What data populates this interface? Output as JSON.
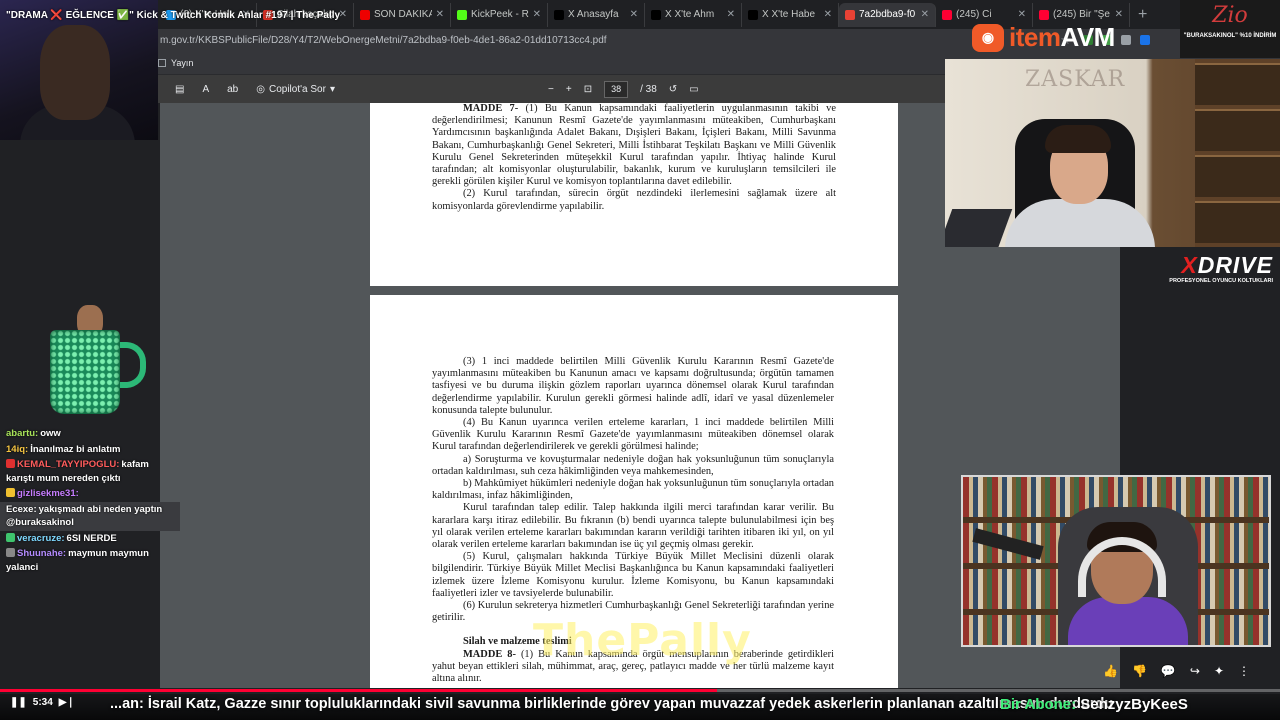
{
  "browser": {
    "tabs": [
      {
        "title": "(6) X'te Hal",
        "color": "#1d9bf0"
      },
      {
        "title": "Silah kaçakç",
        "color": "#d93025"
      },
      {
        "title": "SON DAKİKA",
        "color": "#e00"
      },
      {
        "title": "KickPeek - R",
        "color": "#53fc18"
      },
      {
        "title": "X Anasayfa",
        "color": "#000000"
      },
      {
        "title": "X X'te Ahm",
        "color": "#000000"
      },
      {
        "title": "X X'te Habe",
        "color": "#000000"
      },
      {
        "title": "7a2bdba9-f0",
        "color": "#e94235",
        "active": true
      },
      {
        "title": "(245) Ci",
        "color": "#ff0033"
      },
      {
        "title": "(245) Bir \"Şe",
        "color": "#ff0033"
      }
    ],
    "url": "m.gov.tr/KKBSPublicFile/D28/Y4/T2/WebOnergeMetni/7a2bdba9-f0eb-4de1-86a2-01dd10713cc4.pdf",
    "bookmark": "Yayın"
  },
  "pdf_toolbar": {
    "copilot": "Copilot'a Sor",
    "current_page": "38",
    "total_pages": "/ 38",
    "zoom_out": "−",
    "zoom_in": "+"
  },
  "document": {
    "page1": {
      "article_title": "MADDE 7-",
      "para1": "(1) Bu Kanun kapsamındaki faaliyetlerin uygulanmasının takibi ve değerlendirilmesi; Kanunun Resmî Gazete'de yayımlanmasını müteakiben, Cumhurbaşkanı Yardımcısının başkanlığında Adalet Bakanı, Dışişleri Bakanı, İçişleri Bakanı, Milli Savunma Bakanı, Cumhurbaşkanlığı Genel Sekreteri, Milli İstihbarat Teşkilatı Başkanı ve Milli Güvenlik Kurulu Genel Sekreterinden müteşekkil Kurul tarafından yapılır. İhtiyaç halinde Kurul tarafından; alt komisyonlar oluşturulabilir, bakanlık, kurum ve kuruluşların temsilcileri ile gerekli görülen kişiler Kurul ve komisyon toplantılarına davet edilebilir.",
      "para2": "(2) Kurul tarafından, sürecin örgüt nezdindeki ilerlemesini sağlamak üzere alt komisyonlarda görevlendirme yapılabilir."
    },
    "page2": {
      "p3": "(3) 1 inci maddede belirtilen Milli Güvenlik Kurulu Kararının Resmî Gazete'de yayımlanmasını müteakiben bu Kanunun amacı ve kapsamı doğrultusunda; örgütün tamamen tasfiyesi ve bu duruma ilişkin gözlem raporları uyarınca dönemsel olarak Kurul tarafından değerlendirme yapılabilir. Kurulun gerekli görmesi halinde adlî, idarî ve yasal düzenlemeler konusunda talepte bulunulur.",
      "p4": "(4) Bu Kanun uyarınca verilen erteleme kararları, 1 inci maddede belirtilen Milli Güvenlik Kurulu Kararının Resmî Gazete'de yayımlanmasını müteakiben dönemsel olarak Kurul tarafından değerlendirilerek ve gerekli görülmesi halinde;",
      "pa": "a) Soruşturma ve kovuşturmalar nedeniyle doğan hak yoksunluğunun tüm sonuçlarıyla ortadan kaldırılması, suh ceza hâkimliğinden veya mahkemesinden,",
      "pb": "b) Mahkûmiyet hükümleri nedeniyle doğan hak yoksunluğunun tüm sonuçlarıyla ortadan kaldırılması, infaz hâkimliğinden,",
      "pc": "Kurul tarafından talep edilir. Talep hakkında ilgili merci tarafından karar verilir. Bu kararlara karşı itiraz edilebilir. Bu fıkranın (b) bendi uyarınca talepte bulunulabilmesi için beş yıl olarak verilen erteleme kararları bakımından kararın verildiği tarihten itibaren iki yıl, on yıl olarak verilen erteleme kararları bakımından ise üç yıl geçmiş olması gerekir.",
      "p5": "(5) Kurul, çalışmaları hakkında Türkiye Büyük Millet Meclisini düzenli olarak bilgilendirir. Türkiye Büyük Millet Meclisi Başkanlığınca bu Kanun kapsamındaki faaliyetleri izlemek üzere İzleme Komisyonu kurulur. İzleme Komisyonu, bu Kanun kapsamındaki faaliyetleri izler ve tavsiyelerde bulunabilir.",
      "p6": "(6) Kurulun sekreterya hizmetleri Cumhurbaşkanlığı Genel Sekreterliği tarafından yerine getirilir.",
      "heading": "Silah ve malzeme teslimi",
      "m8title": "MADDE 8-",
      "m8": "(1) Bu Kanun kapsamında örgüt mensuplarının beraberinde getirdikleri yahut beyan ettikleri silah, mühimmat, araç, gereç, patlayıcı madde ve her türlü malzeme kayıt altına alınır."
    },
    "watermark": "ThePally"
  },
  "stream": {
    "title": "\"DRAMA ❌ EĞLENCE ✅\" Kick & Twitch Komik Anlar #197 | The Pally",
    "itemavm": {
      "brand1": "item",
      "brand2": "AVM"
    },
    "zio": {
      "logo": "Zio",
      "promo": "\"BURAKSAKINOL\" %10 İNDİRİM"
    },
    "xdrive": {
      "brand1": "X",
      "brand2": "DRIVE",
      "tagline": "PROFESYONEL OYUNCU KOLTUKLARI"
    },
    "cam2_brand": "ZASKAR"
  },
  "chat": [
    {
      "user": "abartu:",
      "text": "oww",
      "user_color": "#a8e35a",
      "highlight": false,
      "badge": ""
    },
    {
      "user": "14iq:",
      "text": "İnanılmaz bi anlatım",
      "user_color": "#f5c542",
      "highlight": false,
      "badge": ""
    },
    {
      "user": "KEMAL_TAYYIPOGLU:",
      "text": "kafam karıştı mum nereden çıktı",
      "user_color": "#ff5c5c",
      "highlight": false,
      "badge": "#e03030"
    },
    {
      "user": "gizlisekme31:",
      "text": "",
      "user_color": "#c77dff",
      "highlight": false,
      "badge": "#f0c030"
    },
    {
      "user": "Ecexe:",
      "text": "yakışmadı abi neden yaptın @buraksakinol",
      "user_color": "#ffffff",
      "highlight": true,
      "badge": ""
    },
    {
      "user": "veracruze:",
      "text": "6SI NERDE",
      "user_color": "#7fd9ff",
      "highlight": false,
      "badge": "#3ec46d"
    },
    {
      "user": "Shuunahe:",
      "text": "maymun maymun yalanci",
      "user_color": "#b48cff",
      "highlight": false,
      "badge": "#888888"
    }
  ],
  "player": {
    "time": "5:34",
    "progress": 0.56,
    "ticker": "...an: İsrail Katz, Gazze sınır topluluklarındaki sivil savunma birliklerinde görev yapan muvazzaf yedek askerlerin planlanan azaltılmasını durdurdu",
    "subscribe_label": "Bir Abone:",
    "subscriber": "SenzyzByKeeS"
  }
}
